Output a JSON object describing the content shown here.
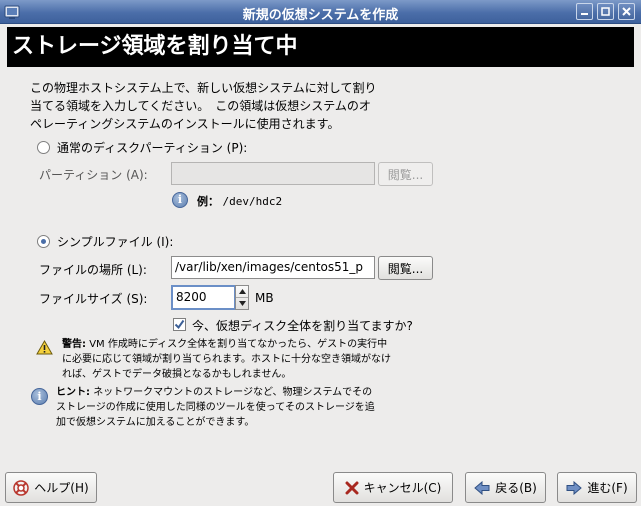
{
  "window": {
    "title": "新規の仮想システムを作成",
    "buttons": [
      "minimize-icon",
      "maximize-icon",
      "close-icon"
    ]
  },
  "banner": {
    "title": "ストレージ領域を割り当て中"
  },
  "intro": {
    "line1": "この物理ホストシステム上で、新しい仮想システムに対して割り",
    "line2": "当てる領域を入力してください。　この領域は仮想システムのオ",
    "line3": "ペレーティングシステムのインストールに使用されます。"
  },
  "partition_option": {
    "label": "通常のディスクパーティション (P):",
    "selected": false,
    "field_label": "パーティション (A):",
    "value": "",
    "browse_label": "閲覧...",
    "example_prefix": "例：",
    "example_value": "/dev/hdc2"
  },
  "file_option": {
    "label": "シンプルファイル (I):",
    "selected": true,
    "location_label": "ファイルの場所 (L):",
    "location_value": "/var/lib/xen/images/centos51_p",
    "browse_label": "閲覧...",
    "size_label": "ファイルサイズ (S):",
    "size_value": "8200",
    "size_unit": "MB",
    "allocate_label": "今、仮想ディスク全体を割り当てますか?",
    "allocate_checked": true
  },
  "warning": {
    "icon": "warning-icon",
    "heading": "警告:",
    "line1": "VM 作成時にディスク全体を割り当てなかったら、ゲストの実行中",
    "line2": "に必要に応じて領域が割り当てられます。ホストに十分な空き領域がなけ",
    "line3": "れば、ゲストでデータ破損となるかもしれません。"
  },
  "hint": {
    "icon": "info-icon",
    "heading": "ヒント:",
    "line1": "ネットワークマウントのストレージなど、物理システムでその",
    "line2": "ストレージの作成に使用した同様のツールを使ってそのストレージを追",
    "line3": "加で仮想システムに加えることができます。"
  },
  "footer": {
    "help_label": "ヘルプ(H)",
    "cancel_label": "キャンセル(C)",
    "back_label": "戻る(B)",
    "forward_label": "進む(F)"
  },
  "colors": {
    "titlebar": "#4b6ea9",
    "banner_bg": "#000000",
    "banner_text": "#ffffff",
    "window_bg": "#edeceb"
  }
}
